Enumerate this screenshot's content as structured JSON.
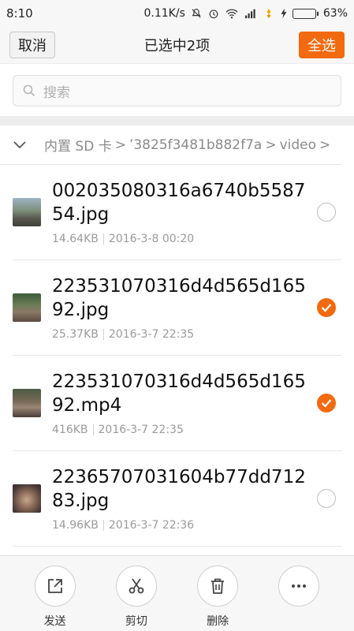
{
  "status_bar": {
    "time": "8:10",
    "speed": "0.11K/s",
    "battery": "63%",
    "battery_level": 0.63,
    "icons": [
      "mute-icon",
      "alarm-icon",
      "wifi-icon",
      "signal-icon",
      "app-notif-icon",
      "charging-icon",
      "battery-icon"
    ]
  },
  "header": {
    "cancel_label": "取消",
    "title": "已选中2项",
    "select_all_label": "全选"
  },
  "search": {
    "placeholder": "搜索"
  },
  "breadcrumb": {
    "parts": [
      "内置 SD 卡",
      "’3825f3481b882f7a",
      "video"
    ]
  },
  "files": [
    {
      "name": "002035080316a6740b558754.jpg",
      "size": "14.64KB",
      "date": "2016-3-8 00:20",
      "selected": false
    },
    {
      "name": "223531070316d4d565d16592.jpg",
      "size": "25.37KB",
      "date": "2016-3-7 22:35",
      "selected": true
    },
    {
      "name": "223531070316d4d565d16592.mp4",
      "size": "416KB",
      "date": "2016-3-7 22:35",
      "selected": true
    },
    {
      "name": "22365707031604b77dd71283.jpg",
      "size": "14.96KB",
      "date": "2016-3-7 22:36",
      "selected": false
    }
  ],
  "actions": [
    {
      "label": "发送",
      "icon": "share-icon"
    },
    {
      "label": "剪切",
      "icon": "scissors-icon"
    },
    {
      "label": "删除",
      "icon": "trash-icon"
    },
    {
      "label": "",
      "icon": "more-icon"
    }
  ],
  "colors": {
    "accent": "#f26a0f",
    "battery_green": "#39b54a"
  }
}
